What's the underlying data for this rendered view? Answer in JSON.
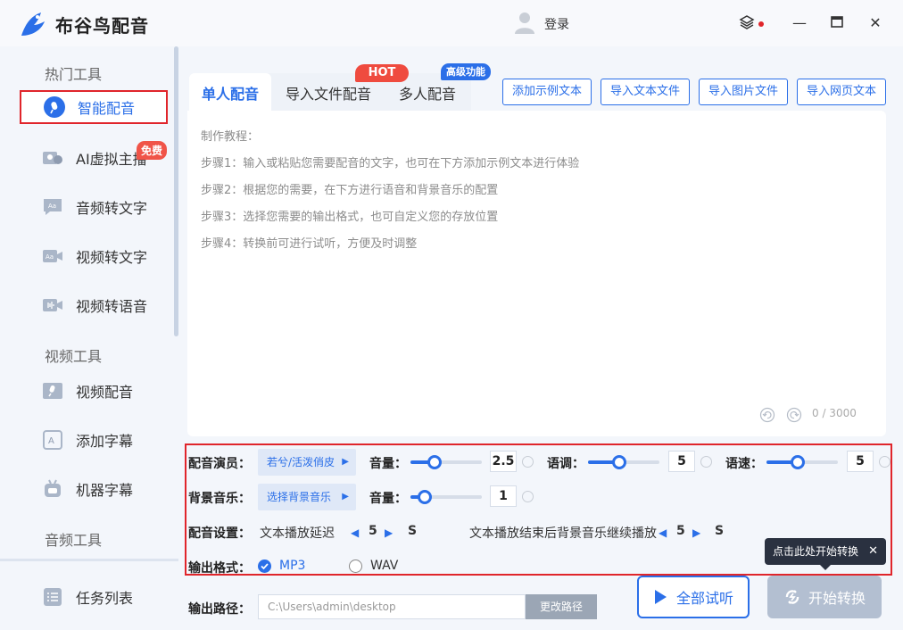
{
  "app": {
    "title": "布谷鸟配音",
    "login": "登录"
  },
  "sidebar": {
    "sections": [
      "热门工具",
      "视频工具",
      "音频工具"
    ],
    "items": [
      {
        "label": "智能配音",
        "icon": "mic-icon",
        "active": true
      },
      {
        "label": "AI虚拟主播",
        "icon": "avatar-host-icon",
        "badge": "免费"
      },
      {
        "label": "音频转文字",
        "icon": "audio-text-icon"
      },
      {
        "label": "视频转文字",
        "icon": "video-text-icon"
      },
      {
        "label": "视频转语音",
        "icon": "video-voice-icon"
      },
      {
        "label": "视频配音",
        "icon": "video-dub-icon"
      },
      {
        "label": "添加字幕",
        "icon": "subtitle-icon"
      },
      {
        "label": "机器字幕",
        "icon": "robot-icon"
      },
      {
        "label": "任务列表",
        "icon": "task-list-icon"
      }
    ]
  },
  "tabs": [
    {
      "label": "单人配音",
      "active": true
    },
    {
      "label": "导入文件配音",
      "badge": "HOT"
    },
    {
      "label": "多人配音",
      "badge": "高级功能"
    }
  ],
  "actions": [
    "添加示例文本",
    "导入文本文件",
    "导入图片文件",
    "导入网页文本"
  ],
  "guide": [
    "制作教程：",
    "步骤1：输入或粘贴您需要配音的文字，也可在下方添加示例文本进行体验",
    "步骤2：根据您的需要，在下方进行语音和背景音乐的配置",
    "步骤3：选择您需要的输出格式，也可自定义您的存放位置",
    "步骤4：转换前可进行试听，方便及时调整"
  ],
  "counter": "0 / 3000",
  "settings": {
    "voice_label": "配音演员：",
    "voice_value": "若兮/活泼俏皮",
    "volume_label": "音量：",
    "volume_value": "2.5",
    "volume_level": 0.34,
    "pitch_label": "语调：",
    "pitch_value": "5",
    "pitch_level": 0.44,
    "speed_label": "语速：",
    "speed_value": "5",
    "speed_level": 0.44,
    "bgm_label": "背景音乐：",
    "bgm_value": "选择背景音乐",
    "bgm_volume_label": "音量：",
    "bgm_volume_value": "1",
    "bgm_volume_level": 0.2,
    "config_label": "配音设置：",
    "delay_label": "文本播放延迟",
    "delay_value": "5",
    "delay_unit": "S",
    "bgm_continue_label": "文本播放结束后背景音乐继续播放",
    "bgm_continue_value": "5",
    "bgm_continue_unit": "S",
    "format_label": "输出格式：",
    "formats": [
      {
        "label": "MP3",
        "selected": true
      },
      {
        "label": "WAV",
        "selected": false
      }
    ]
  },
  "tooltip": "点击此处开始转换",
  "output": {
    "label": "输出路径：",
    "path": "C:\\Users\\admin\\desktop",
    "change_label": "更改路径"
  },
  "buttons": {
    "listen": "全部试听",
    "start": "开始转换"
  },
  "colors": {
    "accent": "#2b6fe8",
    "highlight_border": "#e0252b",
    "hot": "#ef4b3f"
  }
}
